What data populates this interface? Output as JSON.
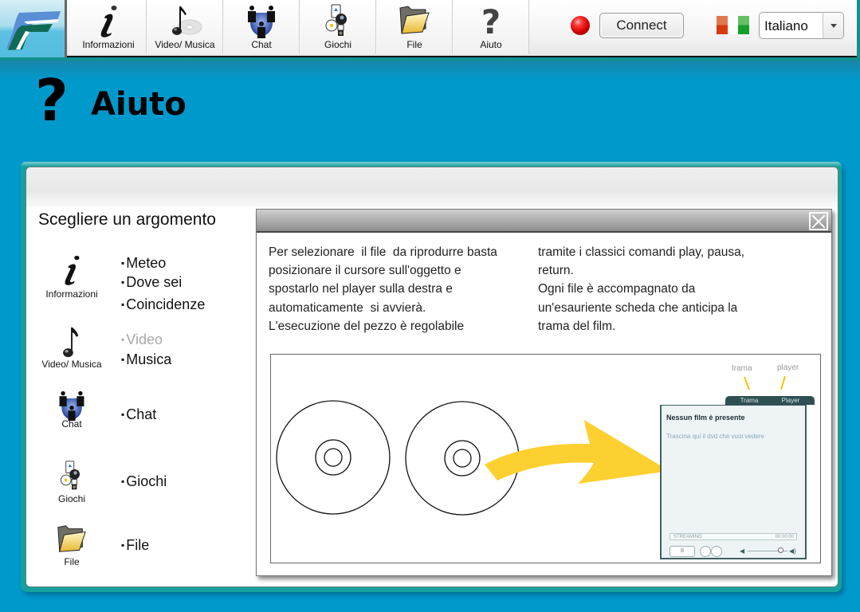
{
  "topbar": {
    "logo_alt": "FS logo",
    "nav": [
      {
        "id": "informazioni",
        "label": "Informazioni",
        "icon": "info-icon"
      },
      {
        "id": "video-musica",
        "label": "Video/ Musica",
        "icon": "music-note-icon"
      },
      {
        "id": "chat",
        "label": "Chat",
        "icon": "people-icon"
      },
      {
        "id": "giochi",
        "label": "Giochi",
        "icon": "games-icon"
      },
      {
        "id": "file",
        "label": "File",
        "icon": "folder-icon"
      },
      {
        "id": "aiuto",
        "label": "Aiuto",
        "icon": "question-icon"
      }
    ],
    "status": {
      "state": "disconnected",
      "color": "#cc0000"
    },
    "connect_label": "Connect",
    "language": {
      "selected": "Italiano",
      "flag": [
        "#d63a10",
        "#ffffff",
        "#16a02a"
      ]
    }
  },
  "page": {
    "icon": "?",
    "title": "Aiuto"
  },
  "topics": {
    "title": "Scegliere un argomento",
    "items": [
      {
        "label": "Informazioni",
        "icon": "info-icon",
        "subs": [
          {
            "label": "Meteo",
            "enabled": true
          },
          {
            "label": "Dove sei",
            "enabled": true
          },
          {
            "label": "Coincidenze",
            "enabled": true
          }
        ]
      },
      {
        "label": "Video/ Musica",
        "icon": "music-note-icon",
        "subs": [
          {
            "label": "Video",
            "enabled": false
          },
          {
            "label": "Musica",
            "enabled": true
          }
        ]
      },
      {
        "label": "Chat",
        "icon": "people-icon",
        "subs": [
          {
            "label": "Chat",
            "enabled": true
          }
        ]
      },
      {
        "label": "Giochi",
        "icon": "games-icon",
        "subs": [
          {
            "label": "Giochi",
            "enabled": true
          }
        ]
      },
      {
        "label": "File",
        "icon": "folder-icon",
        "subs": [
          {
            "label": "File",
            "enabled": true
          }
        ]
      }
    ]
  },
  "help": {
    "col1": "Per selezionare  il file  da riprodurre basta\nposizionare il cursore sull'oggetto e\nspostarlo nel player sulla destra e\nautomaticamente  si avvierà.\nL'esecuzione del pezzo è regolabile",
    "col2": "tramite i classici comandi play, pausa,\nreturn.\nOgni file è accompagnato da\nun'esauriente scheda che anticipa la\ntrama del film.",
    "illustration": {
      "annot_trama": "trama",
      "annot_player": "player",
      "tab_trama": "Trama",
      "tab_player": "Player",
      "player_title": "Nessun film è presente",
      "player_hint": "Trascina qui il dvd che vuoi vedere",
      "status_text": "STREAMING",
      "time_text": "00:00:00",
      "pause_label": "II",
      "arrow_color": "#fcd030"
    }
  }
}
